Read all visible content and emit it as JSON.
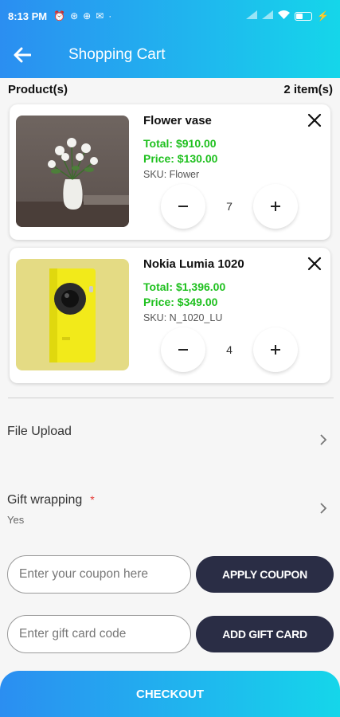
{
  "status_bar": {
    "time": "8:13 PM",
    "icons": [
      "alarm-icon",
      "sync-icon",
      "nfc-icon",
      "mail-icon",
      "dot-icon"
    ],
    "right_icons": [
      "signal-icon",
      "signal-icon",
      "wifi-icon",
      "battery-icon",
      "charging-icon"
    ],
    "battery": "31"
  },
  "app_bar": {
    "back_icon": "arrow-left-icon",
    "title": "Shopping Cart"
  },
  "products": {
    "header_left": "Product(s)",
    "header_right": "2 item(s)",
    "items": [
      {
        "name": "Flower vase",
        "total": "Total: $910.00",
        "price": "Price: $130.00",
        "sku": "SKU: Flower",
        "quantity": "7",
        "image": "flower-vase-photo"
      },
      {
        "name": "Nokia Lumia 1020",
        "total": "Total: $1,396.00",
        "price": "Price: $349.00",
        "sku": "SKU: N_1020_LU",
        "quantity": "4",
        "image": "yellow-phone-photo"
      }
    ]
  },
  "options": {
    "file_upload": "File Upload",
    "gift_wrapping": "Gift wrapping",
    "gift_wrapping_required": "*",
    "gift_wrapping_value": "Yes"
  },
  "coupon": {
    "placeholder": "Enter your coupon here",
    "button": "APPLY COUPON"
  },
  "gift_card": {
    "placeholder": "Enter gift card code",
    "button": "ADD GIFT CARD"
  },
  "checkout": {
    "label": "CHECKOUT"
  },
  "colors": {
    "accent_gradient_start": "#2b8ef1",
    "accent_gradient_end": "#15d6ea",
    "price_green": "#1ec01e",
    "dark_button": "#2a2d45",
    "required_red": "#e53935"
  }
}
